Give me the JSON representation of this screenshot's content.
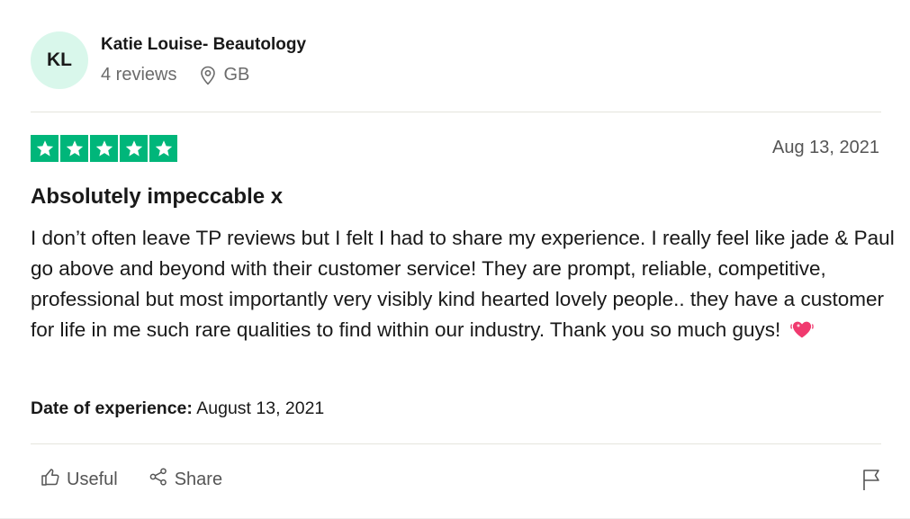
{
  "author": {
    "initials": "KL",
    "name": "Katie Louise- Beautology",
    "reviews_count": "4 reviews",
    "country": "GB"
  },
  "review": {
    "rating": 5,
    "date": "Aug 13, 2021",
    "title": "Absolutely impeccable x",
    "body": "I don’t often leave TP reviews but I felt I had to share my experience. I really feel like jade & Paul go above and beyond with their customer service! They are prompt, reliable, competitive, professional but most importantly very visibly kind hearted lovely people.. they have a customer for life in me such rare qualities to find within our industry. Thank you so much guys!",
    "experience_label": "Date of experience:",
    "experience_date": " August 13, 2021"
  },
  "actions": {
    "useful_label": "Useful",
    "share_label": "Share"
  },
  "icons": {
    "location": "location-pin-icon",
    "star": "star-icon",
    "heart": "beating-heart-emoji-icon",
    "useful": "thumbs-up-icon",
    "share": "share-icon",
    "flag": "flag-icon"
  },
  "colors": {
    "star_green": "#00b67a",
    "avatar_bg": "#d9f7eb",
    "heart_pink": "#f03a6f"
  }
}
